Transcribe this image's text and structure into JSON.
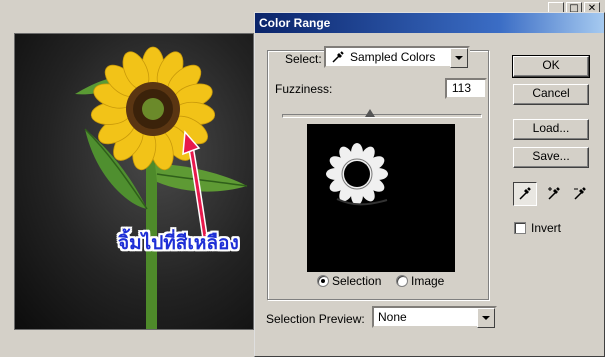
{
  "dialog": {
    "title": "Color Range",
    "select_label": "Select:",
    "select_value": "Sampled Colors",
    "fuzziness_label": "Fuzziness:",
    "fuzziness_value": "113",
    "fuzziness_fraction": 0.44,
    "radio_selection": "Selection",
    "radio_image": "Image",
    "selected_view": "Selection",
    "preview_label": "Selection Preview:",
    "preview_value": "None",
    "buttons": {
      "ok": "OK",
      "cancel": "Cancel",
      "load": "Load...",
      "save": "Save..."
    },
    "invert_label": "Invert",
    "invert_checked": false
  },
  "annotation": {
    "text": "จิ้มไปที่สีเหลือง",
    "color": "#e8194c"
  },
  "background_window": {
    "minimize_icon": "minimize-icon",
    "maximize_icon": "maximize-icon",
    "close_icon": "close-icon"
  },
  "colors": {
    "title_start": "#0a246a",
    "title_end": "#a6caf0",
    "face": "#d4d0c8",
    "flower_yellow": "#f2c318",
    "annotation_text": "#1e2fd6"
  }
}
